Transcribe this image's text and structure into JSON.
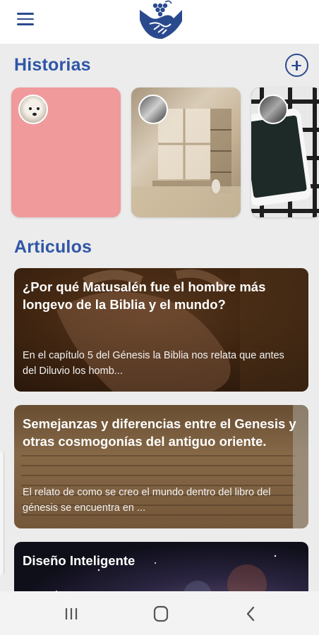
{
  "header": {
    "menu_icon": "hamburger-menu-icon",
    "logo": "handshake-grapes-logo"
  },
  "stories": {
    "title": "Historias",
    "add_icon": "plus-circle-icon",
    "items": [
      {
        "color": "#f09a9c",
        "avatar": "dog-avatar"
      },
      {
        "color": "#b9a58a",
        "avatar": "people-avatar"
      },
      {
        "color": "#3b3b3b",
        "avatar": "people-avatar"
      }
    ]
  },
  "articles": {
    "title": "Articulos",
    "items": [
      {
        "title": "¿Por qué Matusalén fue el hombre más longevo de la Biblia y el mundo?",
        "excerpt": "En el capítulo 5 del Génesis la Biblia nos relata que antes del Diluvio los homb..."
      },
      {
        "title": "Semejanzas y diferencias entre el Genesis y otras cosmogonías del antiguo oriente.",
        "excerpt": "El relato de como se creo el mundo dentro del libro del génesis se encuentra en ..."
      },
      {
        "title": "Diseño Inteligente",
        "excerpt": ""
      }
    ]
  },
  "navigation_bar": {
    "recents_icon": "recent-apps-icon",
    "home_icon": "home-icon",
    "back_icon": "back-icon"
  }
}
